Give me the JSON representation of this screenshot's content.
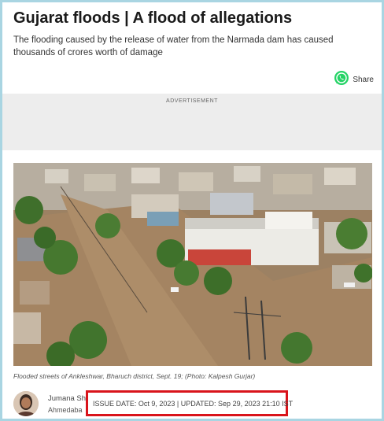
{
  "article": {
    "title": "Gujarat floods | A flood of allegations",
    "subtitle": "The flooding caused by the release of water from the Narmada dam has caused thousands of crores worth of damage",
    "share_label": "Share",
    "advertisement_label": "ADVERTISEMENT",
    "photo_caption": "Flooded streets of Ankleshwar, Bharuch district, Sept. 19; (Photo: Kalpesh Gurjar)",
    "author_name": "Jumana Sha",
    "author_location": "Ahmedaba",
    "dates_text": "ISSUE DATE: Oct 9, 2023 | UPDATED: Sep 29, 2023 21:10 IST"
  },
  "icons": {
    "share": "whatsapp-icon"
  },
  "colors": {
    "frame_border": "#a9d5e2",
    "highlight_box": "#d9141b",
    "whatsapp_green": "#25d366"
  }
}
